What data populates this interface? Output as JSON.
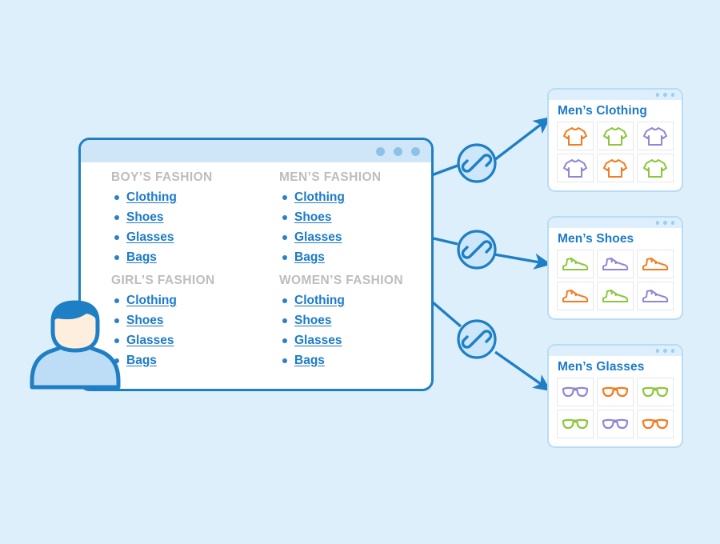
{
  "page": {
    "background_color": "#deeffc",
    "accent_blue": "#1b7ac9",
    "border_blue": "#1f7fc4",
    "heading_gray": "#bdbdbd"
  },
  "browser": {
    "title_dots": [
      "dot-1",
      "dot-2",
      "dot-3"
    ],
    "categories": [
      {
        "id": "boys-fashion",
        "title": "BOY’S FASHION",
        "links": [
          "Clothing",
          "Shoes",
          "Glasses",
          "Bags"
        ]
      },
      {
        "id": "mens-fashion",
        "title": "MEN’S FASHION",
        "links": [
          "Clothing",
          "Shoes",
          "Glasses",
          "Bags"
        ],
        "linked_items": [
          "Clothing",
          "Shoes",
          "Glasses"
        ]
      },
      {
        "id": "girls-fashion",
        "title": "GIRL’S FASHION",
        "links": [
          "Clothing",
          "Shoes",
          "Glasses",
          "Bags"
        ]
      },
      {
        "id": "womens-fashion",
        "title": "WOMEN’S FASHION",
        "links": [
          "Clothing",
          "Shoes",
          "Glasses",
          "Bags"
        ]
      }
    ]
  },
  "link_badges": [
    {
      "id": "link-badge-clothing",
      "icon": "chain-link-icon",
      "target": "Men’s Clothing"
    },
    {
      "id": "link-badge-shoes",
      "icon": "chain-link-icon",
      "target": "Men’s Shoes"
    },
    {
      "id": "link-badge-glasses",
      "icon": "chain-link-icon",
      "target": "Men’s Glasses"
    }
  ],
  "cards": [
    {
      "id": "card-mens-clothing",
      "title": "Men’s Clothing",
      "icon": "tshirt-icon",
      "thumbs": [
        {
          "color": "#f47b20"
        },
        {
          "color": "#8cc63e"
        },
        {
          "color": "#8f87d6"
        },
        {
          "color": "#8f87d6"
        },
        {
          "color": "#f47b20"
        },
        {
          "color": "#8cc63e"
        }
      ]
    },
    {
      "id": "card-mens-shoes",
      "title": "Men’s Shoes",
      "icon": "sneaker-icon",
      "thumbs": [
        {
          "color": "#8cc63e"
        },
        {
          "color": "#8f87d6"
        },
        {
          "color": "#f47b20"
        },
        {
          "color": "#f47b20"
        },
        {
          "color": "#8cc63e"
        },
        {
          "color": "#8f87d6"
        }
      ]
    },
    {
      "id": "card-mens-glasses",
      "title": "Men’s Glasses",
      "icon": "glasses-icon",
      "thumbs": [
        {
          "color": "#8f87d6"
        },
        {
          "color": "#f47b20"
        },
        {
          "color": "#8cc63e"
        },
        {
          "color": "#8cc63e"
        },
        {
          "color": "#8f87d6"
        },
        {
          "color": "#f47b20"
        }
      ]
    }
  ],
  "avatar": {
    "id": "user-avatar",
    "icon": "person-icon",
    "hair_color": "#1f7fc4",
    "face_color": "#fdeedd",
    "body_color": "#bcddf5"
  }
}
